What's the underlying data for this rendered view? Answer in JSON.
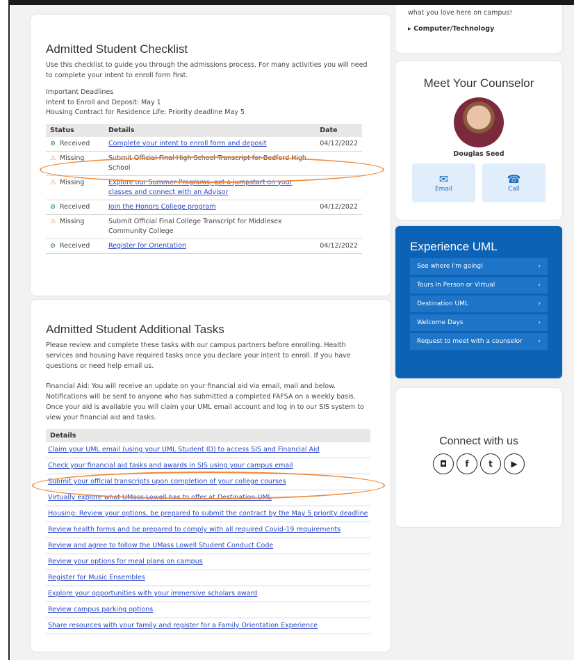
{
  "checklist": {
    "title": "Admitted Student Checklist",
    "intro": "Use this checklist to guide you through the admissions process. For many activities you will need to complete your intent to enroll form first.",
    "deadlines": [
      "Important Deadlines",
      "Intent to Enroll and Deposit: May 1",
      "Housing Contract for Residence Life: Priority deadline May 5"
    ],
    "headers": {
      "status": "Status",
      "details": "Details",
      "date": "Date"
    },
    "rows": [
      {
        "icon": "check-circle-icon",
        "status": "Received",
        "details": "Complete your intent to enroll form and deposit",
        "link": true,
        "date": "04/12/2022"
      },
      {
        "icon": "warning-icon",
        "status": "Missing",
        "details": "Submit Official Final High School Transcript for Bedford High School",
        "link": false,
        "date": ""
      },
      {
        "icon": "warning-icon",
        "status": "Missing",
        "details": "Explore our Summer Programs, get a jumpstart on your classes and connect with an Advisor",
        "link": true,
        "date": ""
      },
      {
        "icon": "check-circle-icon",
        "status": "Received",
        "details": "Join the Honors College program",
        "link": true,
        "date": "04/12/2022"
      },
      {
        "icon": "warning-icon",
        "status": "Missing",
        "details": "Submit Official Final College Transcript for Middlesex Community College",
        "link": false,
        "date": ""
      },
      {
        "icon": "check-circle-icon",
        "status": "Received",
        "details": "Register for Orientation",
        "link": true,
        "date": "04/12/2022"
      }
    ]
  },
  "tasks": {
    "title": "Admitted Student Additional Tasks",
    "intro": "Please review and complete these tasks with our campus partners before enrolling. Health services and housing have required tasks once you declare your intent to enroll. If you have questions or need help email us.",
    "financial": "Financial Aid: You will receive an update on your financial aid via email, mail and below. Notifications will be sent to anyone who has submitted a completed FAFSA on a weekly basis. Once your aid is available you will claim your UML email account and log in to our SIS system to view your financial aid and tasks.",
    "header": "Details",
    "items": [
      "Claim your UML email (using your UML Student ID) to access SIS and Financial Aid",
      "Check your financial aid tasks and awards in SIS using your campus email",
      "Submit your official transcripts upon completion of your college courses",
      "Virtually explore what UMass Lowell has to offer at Destination UML",
      "Housing: Review your options, be prepared to submit the contract by the May 5 priority deadline",
      "Review health forms and be prepared to comply with all required Covid-19 requirements",
      "Review and agree to follow the UMass Lowell Student Conduct Code",
      "Review your options for meal plans on campus",
      "Register for Music Ensembles",
      "Explore your opportunities with your immersive scholars award",
      "Review campus parking options",
      "Share resources with your family and register for a Family Orientation Experience"
    ]
  },
  "interests": {
    "text": "what you love here on campus!",
    "item": "▸ Computer/Technology"
  },
  "counselor": {
    "title": "Meet Your Counselor",
    "name": "Douglas Seed",
    "email_label": "Email",
    "call_label": "Call"
  },
  "experience": {
    "title": "Experience UML",
    "items": [
      "See where I'm going!",
      "Tours In Person or Virtual",
      "Destination UML",
      "Welcome Days",
      "Request to meet with a counselor"
    ]
  },
  "connect": {
    "title": "Connect with us",
    "icons": [
      "instagram-icon",
      "facebook-icon",
      "twitter-icon",
      "youtube-icon"
    ]
  },
  "colors": {
    "brand_blue": "#0c62b5",
    "link": "#2b48c2",
    "annotation": "#ef8a3c"
  }
}
